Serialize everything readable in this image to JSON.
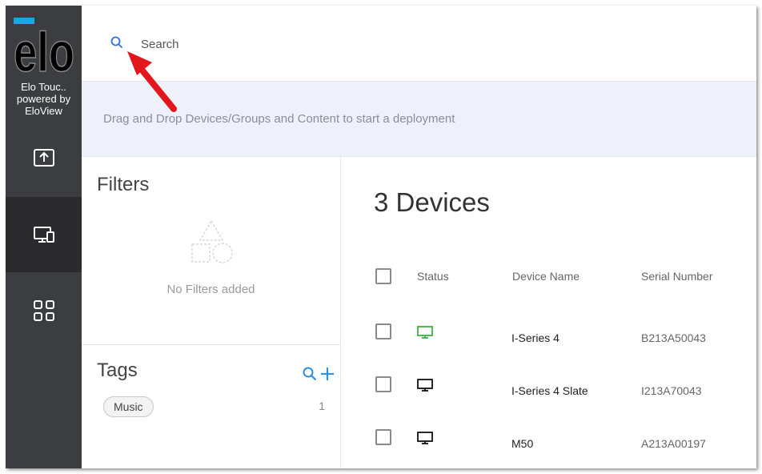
{
  "sidebar": {
    "logo_text": "elo",
    "org_lines": [
      "Elo Touc..",
      "powered by",
      "EloView"
    ],
    "nav": [
      {
        "icon": "upload-screen-icon",
        "active": false
      },
      {
        "icon": "devices-icon",
        "active": true
      },
      {
        "icon": "apps-grid-icon",
        "active": false
      }
    ]
  },
  "search": {
    "placeholder": "Search"
  },
  "drop_zone": {
    "text": "Drag and Drop Devices/Groups and Content to start a deployment"
  },
  "filters": {
    "title": "Filters",
    "empty_text": "No Filters added"
  },
  "tags": {
    "title": "Tags",
    "items": [
      {
        "label": "Music",
        "count": "1"
      }
    ]
  },
  "devices": {
    "title": "3 Devices",
    "columns": {
      "status": "Status",
      "name": "Device Name",
      "serial": "Serial Number"
    },
    "rows": [
      {
        "name": "I-Series 4",
        "serial": "B213A50043",
        "status_color": "#3cb043"
      },
      {
        "name": "I-Series 4 Slate",
        "serial": "I213A70043",
        "status_color": "#111111"
      },
      {
        "name": "M50",
        "serial": "A213A00197",
        "status_color": "#111111"
      }
    ]
  },
  "colors": {
    "accent": "#2f6fd6",
    "annotation": "#e3161d"
  }
}
